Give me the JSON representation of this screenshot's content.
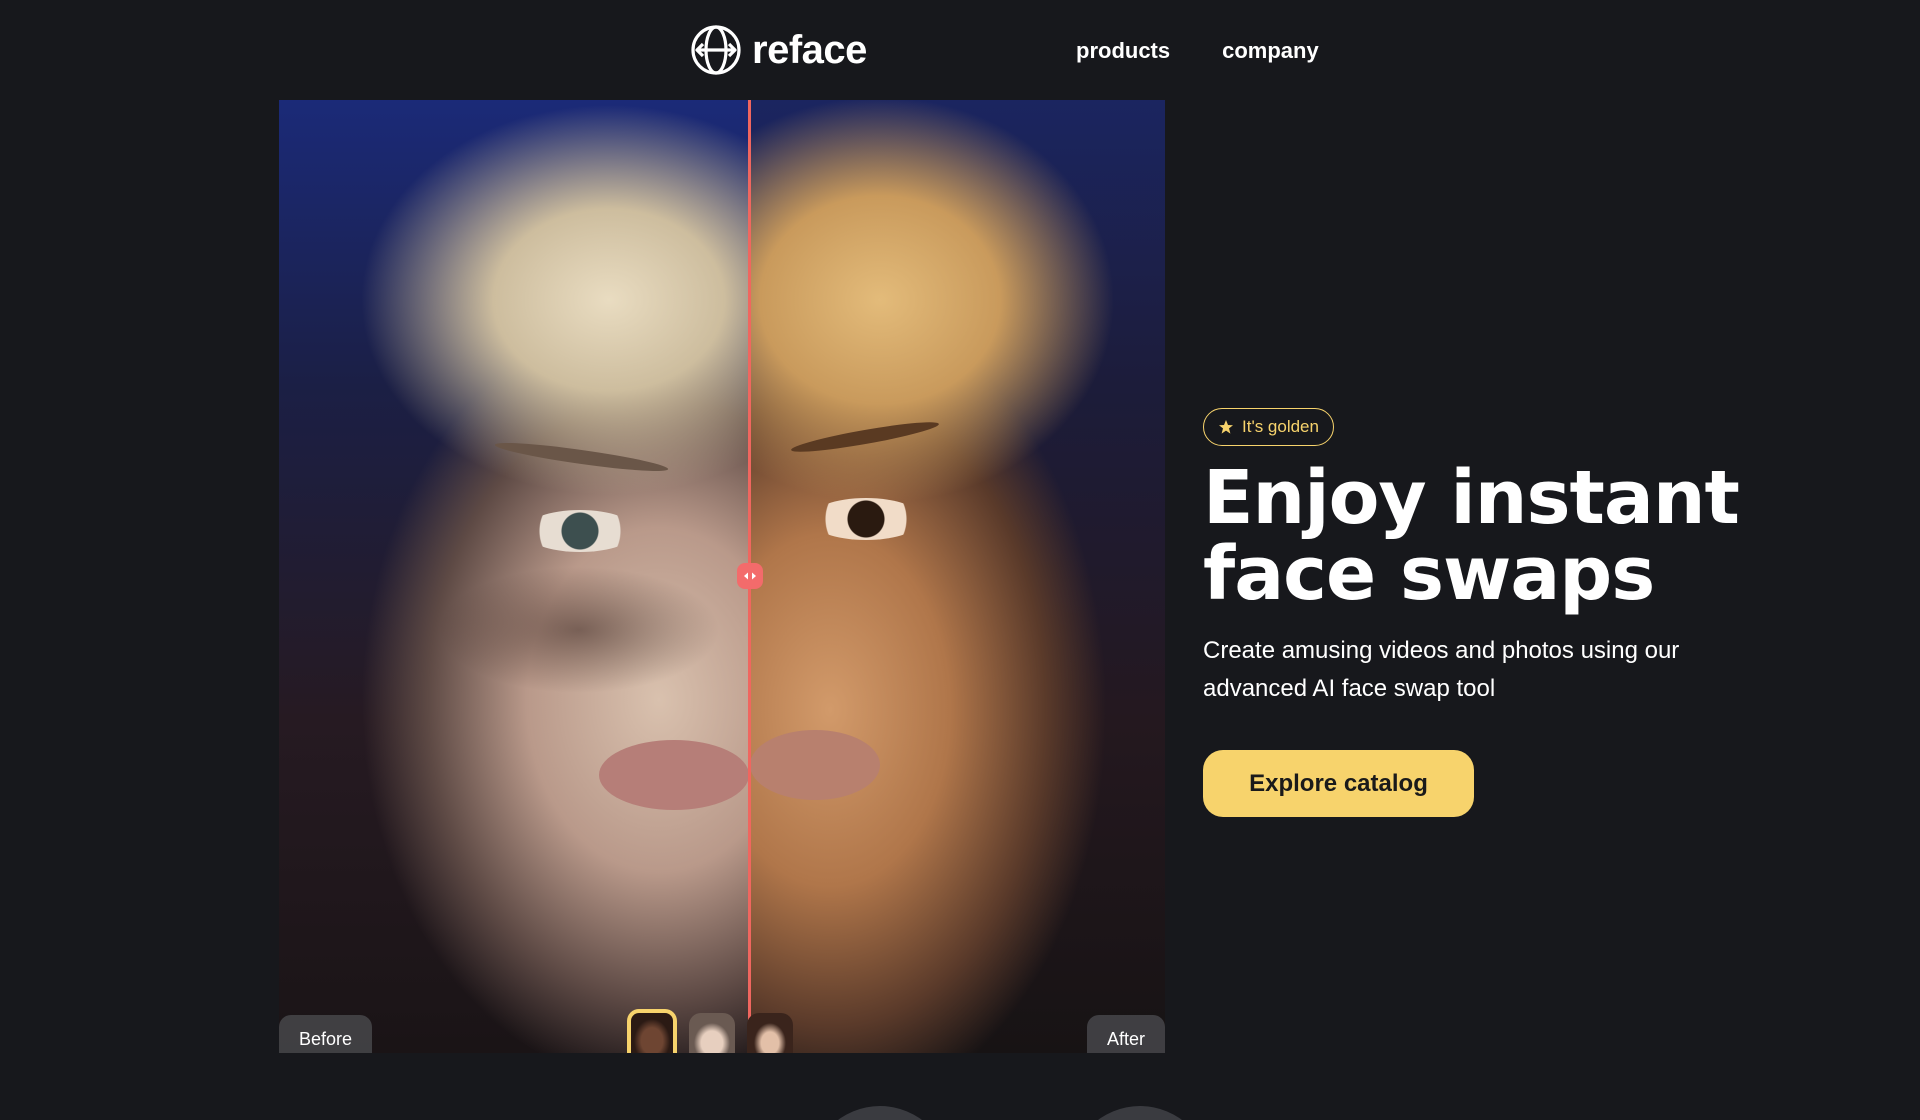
{
  "header": {
    "brand": "reface",
    "nav": [
      {
        "label": "products"
      },
      {
        "label": "company"
      }
    ]
  },
  "comparison": {
    "before_label": "Before",
    "after_label": "After",
    "thumbnails": [
      {
        "name": "face-option-1",
        "selected": true
      },
      {
        "name": "face-option-2",
        "selected": false
      },
      {
        "name": "face-option-3",
        "selected": false
      }
    ]
  },
  "hero": {
    "badge": "It's golden",
    "headline_line1": "Enjoy instant",
    "headline_line2": "face swaps",
    "subtitle": "Create amusing videos and photos using our advanced AI face swap tool",
    "cta": "Explore catalog"
  },
  "colors": {
    "background": "#17181c",
    "accent": "#f7d36c",
    "divider": "#f0665f",
    "text": "#ffffff"
  },
  "icons": {
    "logo": "globe-arrows-icon",
    "badge": "star-icon",
    "handle": "left-right-arrows-icon"
  }
}
